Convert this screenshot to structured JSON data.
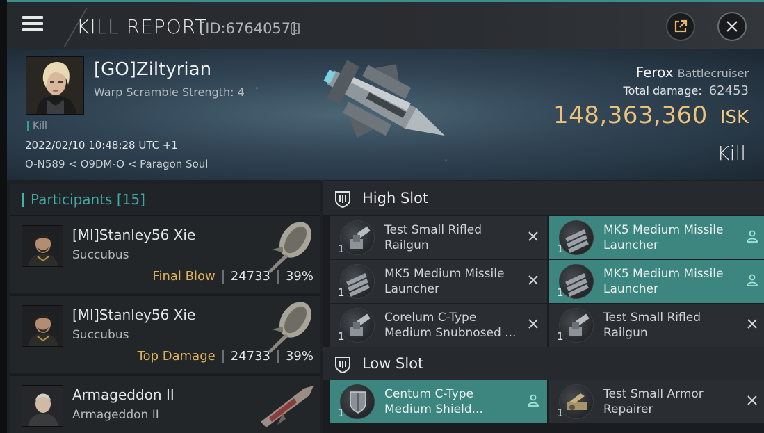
{
  "window": {
    "title": "KILL REPORT",
    "report_id": "[ID:6764057]"
  },
  "victim": {
    "name": "[GO]Ziltyrian",
    "subtext": "Warp Scramble Strength: 4",
    "tag": "Kill",
    "datetime": "2022/02/10 10:48:28 UTC +1",
    "location": "O-N589 < O9DM-O < Paragon Soul",
    "ship_name": "Ferox",
    "ship_class": "Battlecruiser",
    "total_damage_label": "Total damage:",
    "total_damage": "62453",
    "isk_value": "148,363,360",
    "isk_unit": "ISK",
    "result": "Kill"
  },
  "participants": {
    "header": "Participants [15]",
    "rows": [
      {
        "name": "[MI]Stanley56 Xie",
        "ship": "Succubus",
        "role": "Final Blow",
        "damage": "24733",
        "percent": "39%"
      },
      {
        "name": "[MI]Stanley56 Xie",
        "ship": "Succubus",
        "role": "Top Damage",
        "damage": "24733",
        "percent": "39%"
      },
      {
        "name": "Armageddon II",
        "ship": "Armageddon II",
        "role": "",
        "damage": "",
        "percent": ""
      }
    ]
  },
  "fitting": {
    "high_slot_label": "High Slot",
    "low_slot_label": "Low Slot",
    "high": [
      {
        "qty": "1",
        "name": "Test Small Rifled Railgun",
        "state": "destroyed",
        "highlight": false
      },
      {
        "qty": "1",
        "name": "MK5 Medium Missile Launcher",
        "state": "dropped",
        "highlight": true
      },
      {
        "qty": "1",
        "name": "MK5 Medium Missile Launcher",
        "state": "destroyed",
        "highlight": false
      },
      {
        "qty": "1",
        "name": "MK5 Medium Missile Launcher",
        "state": "dropped",
        "highlight": true
      },
      {
        "qty": "1",
        "name": "Corelum C-Type Medium Snubnosed ...",
        "state": "destroyed",
        "highlight": false
      },
      {
        "qty": "1",
        "name": "Test Small Rifled Railgun",
        "state": "destroyed",
        "highlight": false
      }
    ],
    "low": [
      {
        "qty": "1",
        "name": "Centum C-Type Medium Shield...",
        "state": "dropped",
        "highlight": true
      },
      {
        "qty": "1",
        "name": "Test Small Armor Repairer",
        "state": "destroyed",
        "highlight": false
      }
    ]
  },
  "colors": {
    "accent": "#3ab5a6",
    "isk": "#ecc27a",
    "role": "#e0b25a",
    "dropped_row": "#3d8680"
  },
  "icons": [
    "menu-icon",
    "copy-icon",
    "external-link-icon",
    "close-icon",
    "shield-slot-icon",
    "person-icon",
    "x-icon"
  ]
}
